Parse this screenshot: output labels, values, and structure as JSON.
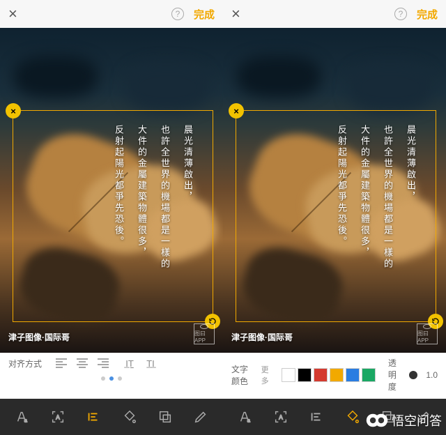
{
  "topbar": {
    "done": "完成"
  },
  "poem": {
    "lines": [
      "晨光清薄啟出，",
      "也許全世界的機場都是一樣的",
      "大件的金屬建築物體很多，",
      "反射起陽光都爭先恐後。"
    ]
  },
  "watermark": "津子图像·国际哥",
  "appwm": "图曰APP",
  "left_controls": {
    "label": "对齐方式",
    "align_group1": [
      "left",
      "center",
      "right"
    ],
    "baseline_buttons": [
      "IT",
      "TI"
    ],
    "active_dot_index": 1,
    "dot_count": 3
  },
  "right_controls": {
    "color_label": "文字颜色",
    "more": "更多",
    "swatches": [
      "#ffffff",
      "#000000",
      "#d43a2f",
      "#f2a900",
      "#2a7de1",
      "#1aa864"
    ],
    "opacity_label": "透明度",
    "opacity_value": "1.0",
    "dot_count": 2,
    "active_dot_index": 0
  },
  "bottom_tools": [
    "font",
    "focus",
    "align",
    "color",
    "layer",
    "edit"
  ],
  "wukong": "悟空问答"
}
